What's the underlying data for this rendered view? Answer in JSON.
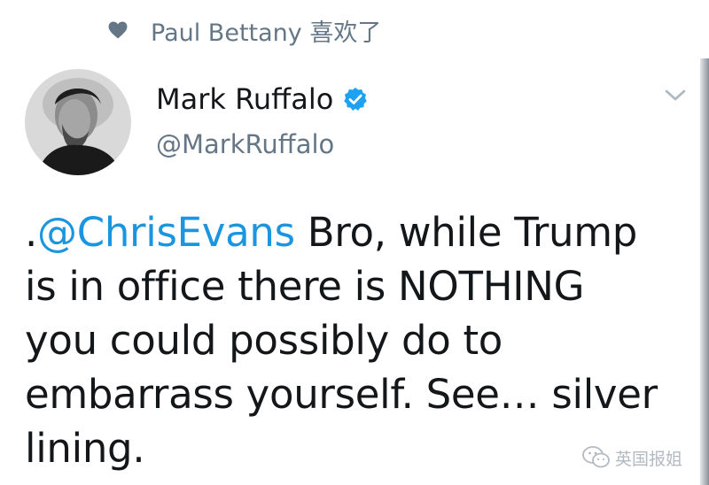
{
  "liked_by": {
    "icon": "heart-icon",
    "text": "Paul Bettany 喜欢了"
  },
  "tweet": {
    "author": {
      "display_name": "Mark Ruffalo",
      "verified": true,
      "verified_icon": "verified-badge-icon",
      "handle": "@MarkRuffalo",
      "avatar": "avatar-photo"
    },
    "menu_icon": "chevron-down-icon",
    "text_lines": [
      {
        "prefix": ".",
        "mention": "@ChrisEvans",
        "rest": " Bro, while Trump"
      },
      {
        "text": "is in office there is NOTHING"
      },
      {
        "text": "you could possibly do to"
      },
      {
        "text": "embarrass yourself. See… silver"
      },
      {
        "text": "lining."
      }
    ]
  },
  "watermark": {
    "icon": "wechat-icon",
    "text": "英国报姐"
  },
  "colors": {
    "mention": "#1b95e0",
    "verified": "#1da1f2",
    "secondary_text": "#657786",
    "primary_text": "#14171a"
  }
}
